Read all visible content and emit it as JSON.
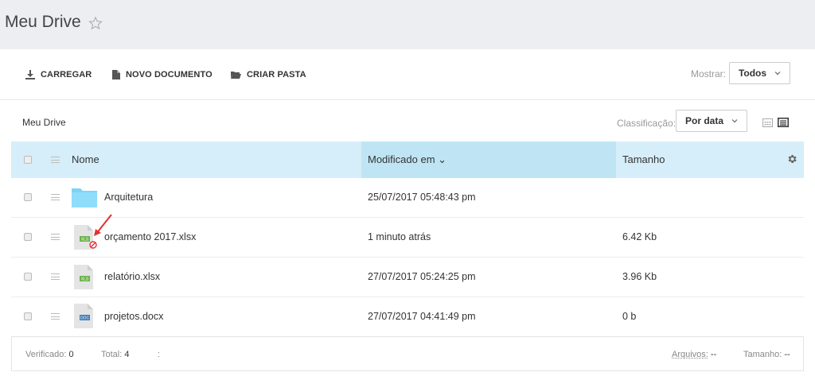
{
  "header": {
    "title": "Meu Drive"
  },
  "toolbar": {
    "upload_label": "CARREGAR",
    "new_doc_label": "NOVO DOCUMENTO",
    "new_folder_label": "CRIAR PASTA",
    "show_label": "Mostrar:",
    "show_value": "Todos"
  },
  "breadcrumb": "Meu Drive",
  "sort": {
    "label": "Classificação:",
    "value": "Por data"
  },
  "table": {
    "columns": {
      "name": "Nome",
      "modified": "Modificado em ⌄",
      "size": "Tamanho"
    },
    "rows": [
      {
        "type": "folder",
        "name": "Arquitetura",
        "modified": "25/07/2017 05:48:43 pm",
        "size": ""
      },
      {
        "type": "xls",
        "name": "orçamento 2017.xlsx",
        "modified": "1 minuto atrás",
        "size": "6.42 Kb",
        "blocked": true
      },
      {
        "type": "xls",
        "name": "relatório.xlsx",
        "modified": "27/07/2017 05:24:25 pm",
        "size": "3.96 Kb"
      },
      {
        "type": "doc",
        "name": "projetos.docx",
        "modified": "27/07/2017 04:41:49 pm",
        "size": "0 b"
      }
    ]
  },
  "footer": {
    "verified_label": "Verificado:",
    "verified_value": "0",
    "total_label": "Total:",
    "total_value": "4",
    "sep": ":",
    "files_label": "Arquivos:",
    "files_value": "--",
    "size_label": "Tamanho:",
    "size_value": "--"
  },
  "icons": {
    "upload": "download-arrow-icon",
    "new_doc": "document-icon",
    "new_folder": "folder-open-icon",
    "settings": "gear-icon",
    "star": "star-outline-icon"
  },
  "colors": {
    "header_bg": "#d6eef9",
    "sorted_col_bg": "#bfe5f5",
    "folder": "#7fd3f7",
    "xls_badge": "#6bb34a",
    "doc_badge": "#3e7ab8",
    "blocked": "#e0322f"
  }
}
